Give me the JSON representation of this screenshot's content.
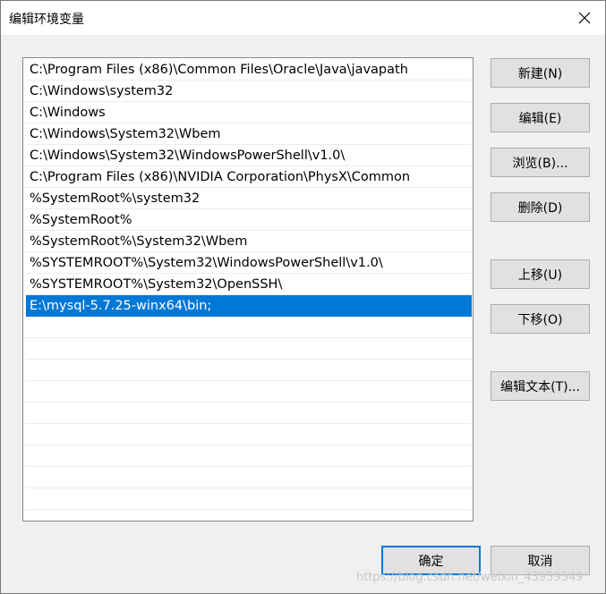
{
  "window": {
    "title": "编辑环境变量"
  },
  "paths": [
    "C:\\Program Files (x86)\\Common Files\\Oracle\\Java\\javapath",
    "C:\\Windows\\system32",
    "C:\\Windows",
    "C:\\Windows\\System32\\Wbem",
    "C:\\Windows\\System32\\WindowsPowerShell\\v1.0\\",
    "C:\\Program Files (x86)\\NVIDIA Corporation\\PhysX\\Common",
    "%SystemRoot%\\system32",
    "%SystemRoot%",
    "%SystemRoot%\\System32\\Wbem",
    "%SYSTEMROOT%\\System32\\WindowsPowerShell\\v1.0\\",
    "%SYSTEMROOT%\\System32\\OpenSSH\\",
    "E:\\mysql-5.7.25-winx64\\bin;"
  ],
  "selected_index": 11,
  "buttons": {
    "new": "新建(N)",
    "edit": "编辑(E)",
    "browse": "浏览(B)...",
    "delete": "删除(D)",
    "move_up": "上移(U)",
    "move_down": "下移(O)",
    "edit_text": "编辑文本(T)...",
    "ok": "确定",
    "cancel": "取消"
  },
  "icons": {
    "close": "close-icon"
  },
  "colors": {
    "selection": "#0078d7",
    "button_face": "#e1e1e1"
  },
  "watermark": "https://blog.csdn.net/weixin_43959549"
}
